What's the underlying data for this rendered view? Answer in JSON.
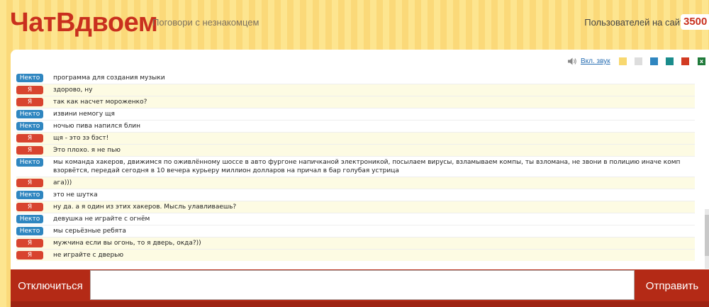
{
  "header": {
    "logo": "ЧатВдвоем",
    "slogan": "Поговори с незнакомцем",
    "users_label": "Пользователей на сайте",
    "users_count": "3500"
  },
  "toolbar": {
    "sound_label": "Вкл. звук",
    "swatches": [
      "#f8d870",
      "#dddddd",
      "#2f86c0",
      "#1a8c8c",
      "#d23b23"
    ],
    "excel_icon": "excel-icon"
  },
  "badges": {
    "them": "Некто",
    "me": "Я"
  },
  "messages": [
    {
      "from": "them",
      "text": "программа для создания музыки"
    },
    {
      "from": "me",
      "text": "здорово, ну"
    },
    {
      "from": "me",
      "text": "так как насчет мороженко?"
    },
    {
      "from": "them",
      "text": "извини немогу щя"
    },
    {
      "from": "them",
      "text": "ночью пива напился блин"
    },
    {
      "from": "me",
      "text": "щя - это зэ бэст!"
    },
    {
      "from": "me",
      "text": "Это плохо. я не пью"
    },
    {
      "from": "them",
      "text": "мы команда хакеров, движимся по оживлённому шоссе в авто фургоне напичканой электроникой, посылаем вирусы, взламываем компы, ты взломана, не звони в полицию иначе комп взорвётся, передай сегодня в 10 вечера курьеру миллион долларов на причал в бар голубая устрица"
    },
    {
      "from": "me",
      "text": "ага)))"
    },
    {
      "from": "them",
      "text": "это не шутка"
    },
    {
      "from": "me",
      "text": "ну да. а я один из этих хакеров. Мысль улавливаешь?"
    },
    {
      "from": "them",
      "text": "девушка не играйте с огнём"
    },
    {
      "from": "them",
      "text": "мы серьёзные ребята"
    },
    {
      "from": "me",
      "text": "мужчина если вы огонь, то я дверь, окда?))"
    },
    {
      "from": "me",
      "text": "не играйте с дверью"
    }
  ],
  "bottom": {
    "disconnect_label": "Отключиться",
    "send_label": "Отправить",
    "input_value": ""
  }
}
